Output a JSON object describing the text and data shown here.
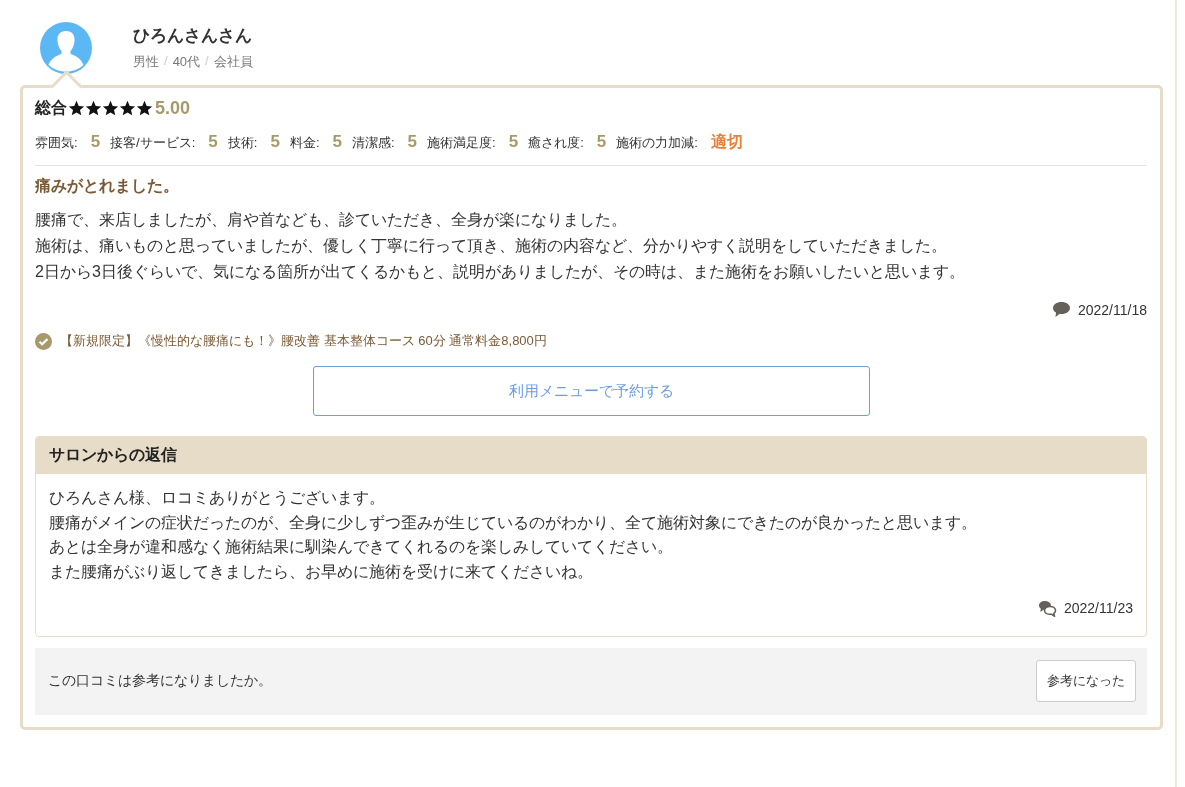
{
  "reviewer": {
    "name": "ひろんさんさん",
    "attributes": [
      "男性",
      "40代",
      "会社員"
    ],
    "separator": "/"
  },
  "rating": {
    "label": "総合",
    "stars": 5,
    "score": "5.00"
  },
  "sub_ratings": [
    {
      "label": "雰囲気:",
      "value": "5",
      "kind": "score"
    },
    {
      "label": "接客/サービス:",
      "value": "5",
      "kind": "score"
    },
    {
      "label": "技術:",
      "value": "5",
      "kind": "score"
    },
    {
      "label": "料金:",
      "value": "5",
      "kind": "score"
    },
    {
      "label": "清潔感:",
      "value": "5",
      "kind": "score"
    },
    {
      "label": "施術満足度:",
      "value": "5",
      "kind": "score"
    },
    {
      "label": "癒され度:",
      "value": "5",
      "kind": "score"
    },
    {
      "label": "施術の力加減:",
      "value": "適切",
      "kind": "word"
    }
  ],
  "review": {
    "title": "痛みがとれました。",
    "body": [
      "腰痛で、来店しましたが、肩や首なども、診ていただき、全身が楽になりました。",
      "施術は、痛いものと思っていましたが、優しく丁寧に行って頂き、施術の内容など、分かりやすく説明をしていただきました。",
      "2日から3日後ぐらいで、気になる箇所が出てくるかもと、説明がありましたが、その時は、また施術をお願いしたいと思います。"
    ],
    "date": "2022/11/18"
  },
  "menu": {
    "text": "【新規限定】《慢性的な腰痛にも！》腰改善 基本整体コース 60分 通常料金8,800円",
    "verified": true
  },
  "reserve_button": "利用メニューで予約する",
  "reply": {
    "heading": "サロンからの返信",
    "body": [
      "ひろんさん様、ロコミありがとうございます。",
      "腰痛がメインの症状だったのが、全身に少しずつ歪みが生じているのがわかり、全て施術対象にできたのが良かったと思います。",
      "あとは全身が違和感なく施術結果に馴染んできてくれるのを楽しみしていてください。",
      "また腰痛がぶり返してきましたら、お早めに施術を受けに来てくださいね。"
    ],
    "date": "2022/11/23"
  },
  "helpful": {
    "question": "この口コミは参考になりましたか。",
    "button": "参考になった"
  }
}
